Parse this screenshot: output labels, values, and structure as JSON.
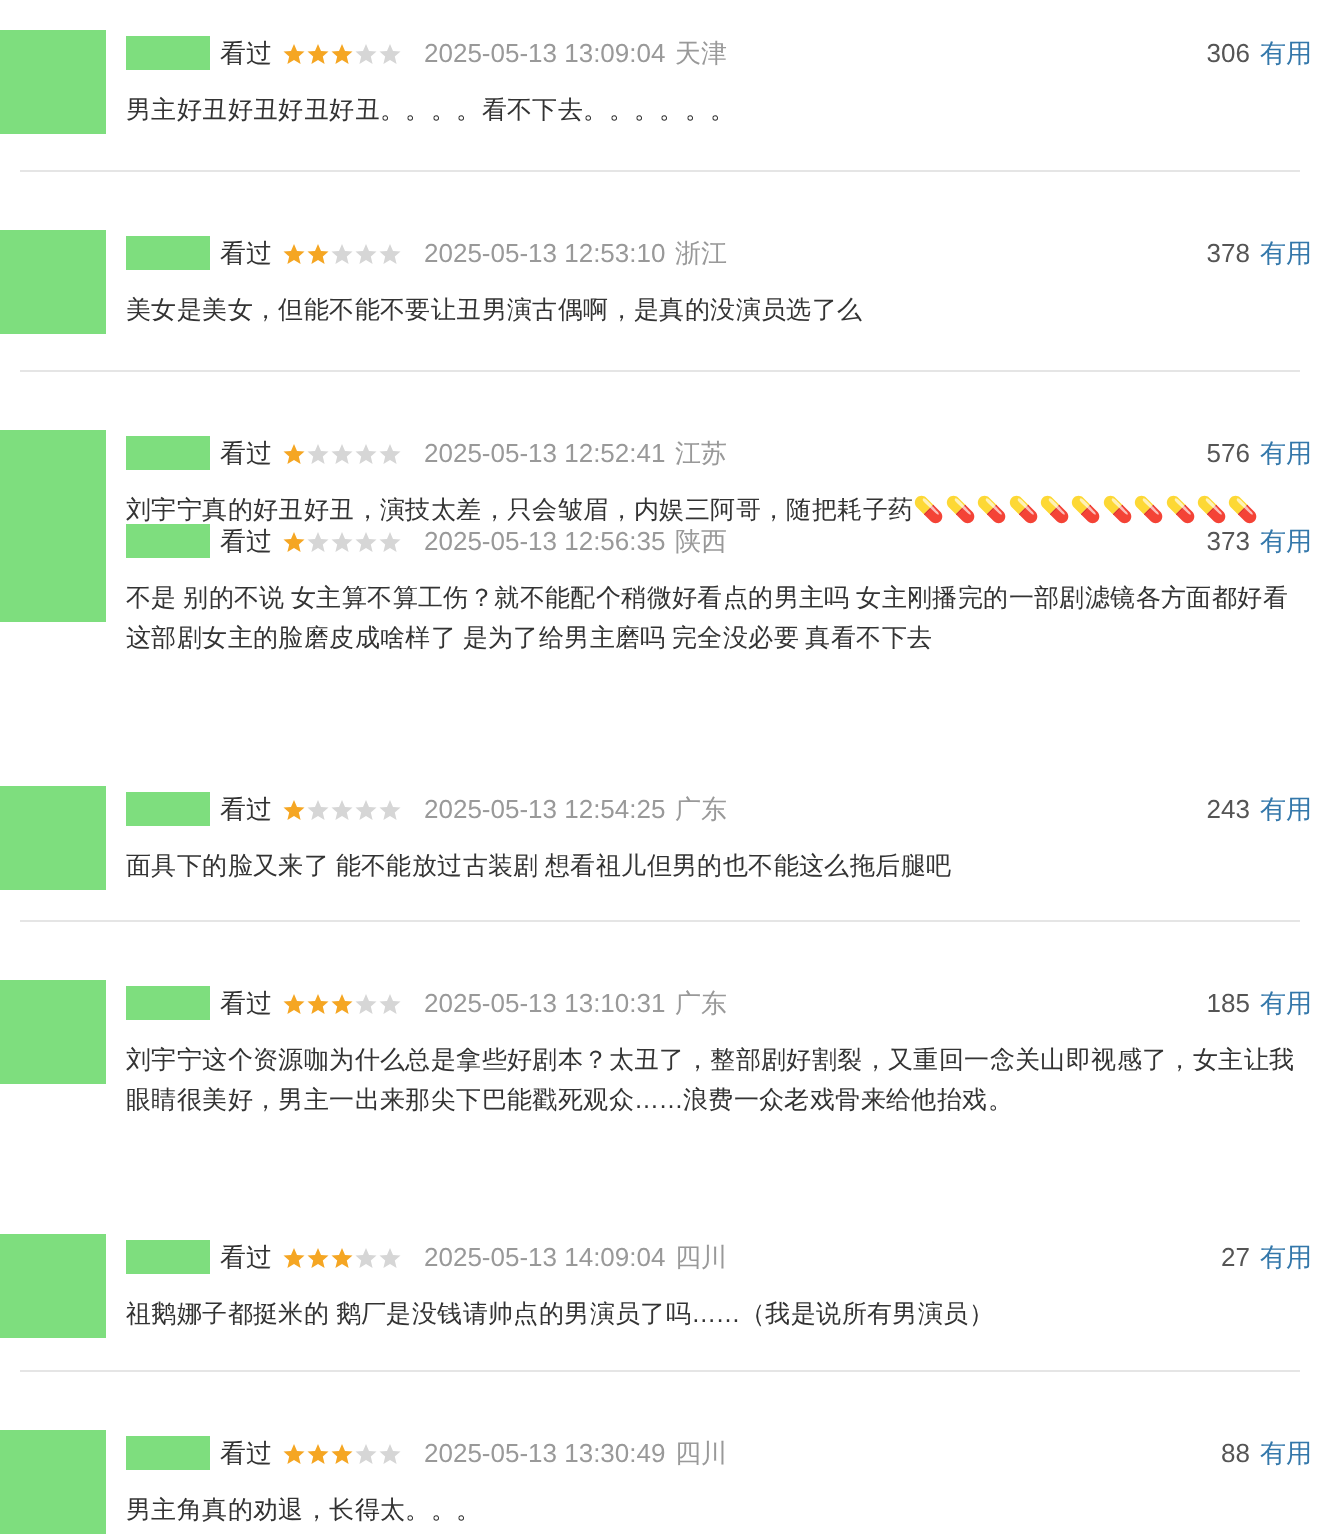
{
  "reviews": [
    {
      "status": "看过",
      "stars": 3,
      "time": "2025-05-13 13:09:04",
      "location": "天津",
      "votes": "306",
      "useful": "有用",
      "text": "男主好丑好丑好丑好丑。。。。看不下去。。。。。。",
      "divider_below": true
    },
    {
      "status": "看过",
      "stars": 2,
      "time": "2025-05-13 12:53:10",
      "location": "浙江",
      "votes": "378",
      "useful": "有用",
      "text": "美女是美女，但能不能不要让丑男演古偶啊，是真的没演员选了么",
      "divider_below": true
    },
    {
      "status": "看过",
      "stars": 1,
      "time": "2025-05-13 12:52:41",
      "location": "江苏",
      "votes": "576",
      "useful": "有用",
      "text": "刘宇宁真的好丑好丑，演技太差，只会皱眉，内娱三阿哥，随把耗子药💊💊💊💊💊💊💊💊💊💊💊",
      "divider_below": false
    },
    {
      "status": "看过",
      "stars": 1,
      "time": "2025-05-13 12:56:35",
      "location": "陕西",
      "votes": "373",
      "useful": "有用",
      "text": "不是 别的不说 女主算不算工伤？就不能配个稍微好看点的男主吗 女主刚播完的一部剧滤镜各方面都好看这部剧女主的脸磨皮成啥样了 是为了给男主磨吗 完全没必要 真看不下去",
      "divider_below": false
    },
    {
      "status": "看过",
      "stars": 1,
      "time": "2025-05-13 12:54:25",
      "location": "广东",
      "votes": "243",
      "useful": "有用",
      "text": "面具下的脸又来了 能不能放过古装剧 想看祖儿但男的也不能这么拖后腿吧",
      "divider_below": true
    },
    {
      "status": "看过",
      "stars": 3,
      "time": "2025-05-13 13:10:31",
      "location": "广东",
      "votes": "185",
      "useful": "有用",
      "text": "刘宇宁这个资源咖为什么总是拿些好剧本？太丑了，整部剧好割裂，又重回一念关山即视感了，女主让我眼睛很美好，男主一出来那尖下巴能戳死观众……浪费一众老戏骨来给他抬戏。",
      "divider_below": false
    },
    {
      "status": "看过",
      "stars": 3,
      "time": "2025-05-13 14:09:04",
      "location": "四川",
      "votes": "27",
      "useful": "有用",
      "text": "祖鹅娜子都挺米的 鹅厂是没钱请帅点的男演员了吗……（我是说所有男演员）",
      "divider_below": true
    },
    {
      "status": "看过",
      "stars": 3,
      "time": "2025-05-13 13:30:49",
      "location": "四川",
      "votes": "88",
      "useful": "有用",
      "text": "男主角真的劝退，长得太。。。",
      "divider_below": false
    }
  ]
}
